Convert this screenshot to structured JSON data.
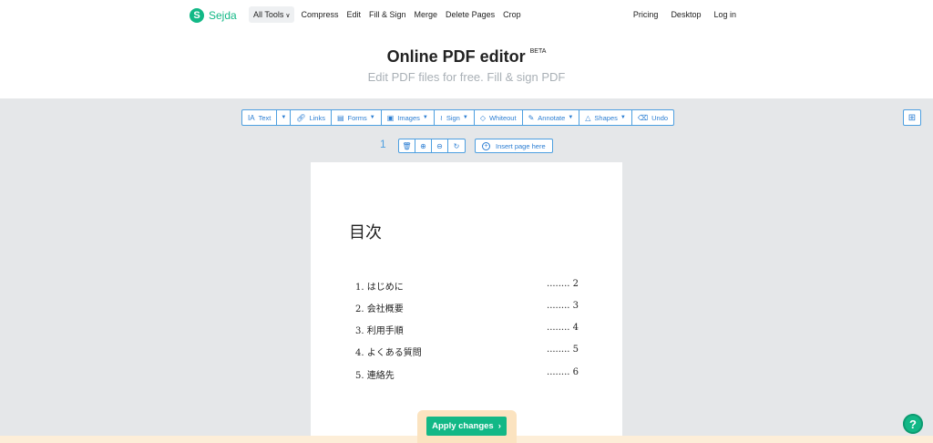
{
  "brand": {
    "logo_letter": "S",
    "name": "Sejda"
  },
  "nav": {
    "items": [
      "All Tools",
      "Compress",
      "Edit",
      "Fill & Sign",
      "Merge",
      "Delete Pages",
      "Crop"
    ],
    "right": [
      "Pricing",
      "Desktop",
      "Log in"
    ]
  },
  "hero": {
    "title": "Online PDF editor",
    "badge": "BETA",
    "subtitle": "Edit PDF files for free. Fill & sign PDF"
  },
  "toolbar": {
    "text": "Text",
    "links": "Links",
    "forms": "Forms",
    "images": "Images",
    "sign": "Sign",
    "whiteout": "Whiteout",
    "annotate": "Annotate",
    "shapes": "Shapes",
    "undo": "Undo"
  },
  "page_controls": {
    "page_number": "1",
    "insert_page": "Insert page here"
  },
  "document": {
    "title": "目次",
    "toc": [
      {
        "label": "1. はじめに",
        "page": "........ 2"
      },
      {
        "label": "2. 会社概要",
        "page": "........ 3"
      },
      {
        "label": "3. 利用手順",
        "page": "........ 4"
      },
      {
        "label": "4. よくある質問",
        "page": "........ 5"
      },
      {
        "label": "5. 連絡先",
        "page": "........ 6"
      }
    ]
  },
  "apply_button": "Apply changes",
  "help_icon_glyph": "?",
  "colors": {
    "brand_green": "#12b886",
    "accent_blue": "#2b7ed3",
    "workspace_gray": "#e5e7e9"
  }
}
